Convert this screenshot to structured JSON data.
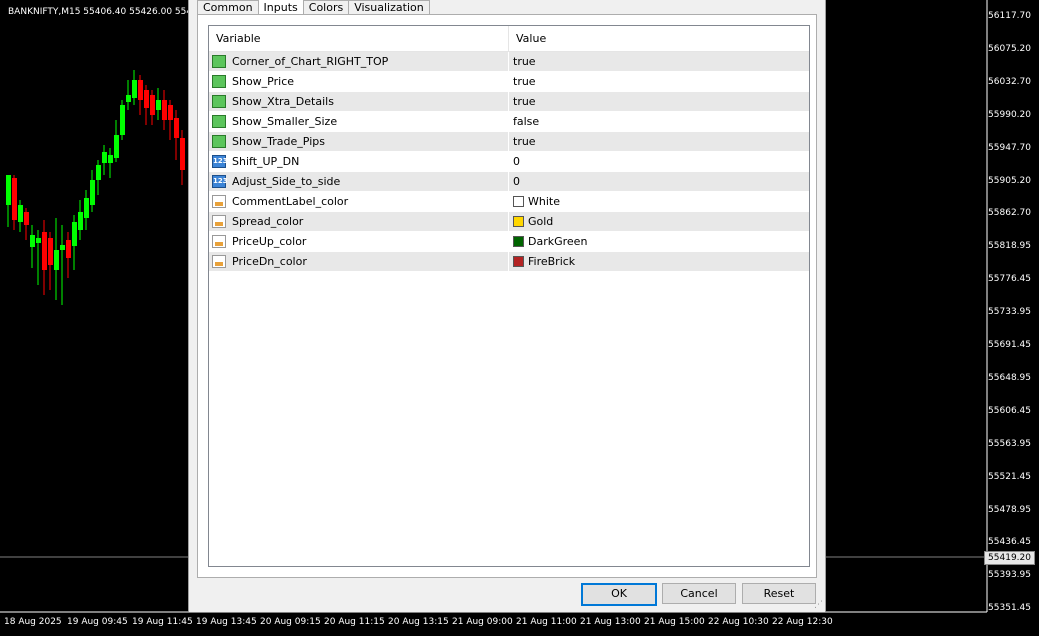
{
  "chart": {
    "title": "BANKNIFTY,M15  55406.40 55426.00 554",
    "y_ticks": [
      "56117.70",
      "56075.20",
      "56032.70",
      "55990.20",
      "55947.70",
      "55905.20",
      "55862.70",
      "55818.95",
      "55776.45",
      "55733.95",
      "55691.45",
      "55648.95",
      "55606.45",
      "55563.95",
      "55521.45",
      "55478.95",
      "55436.45",
      "55393.95",
      "55351.45"
    ],
    "current_price": "55419.20",
    "x_ticks": [
      "18 Aug 2025",
      "19 Aug 09:45",
      "19 Aug 11:45",
      "19 Aug 13:45",
      "20 Aug 09:15",
      "20 Aug 11:15",
      "20 Aug 13:15",
      "21 Aug 09:00",
      "21 Aug 11:00",
      "21 Aug 13:00",
      "21 Aug 15:00",
      "22 Aug 10:30",
      "22 Aug 12:30"
    ],
    "up_color": "#00ff00",
    "down_color": "#ff0000"
  },
  "dialog": {
    "tabs": [
      "Common",
      "Inputs",
      "Colors",
      "Visualization"
    ],
    "active_tab": "Inputs",
    "columns": {
      "variable": "Variable",
      "value": "Value"
    },
    "rows": [
      {
        "name": "Corner_of_Chart_RIGHT_TOP",
        "value": "true",
        "icon": "bool-icon"
      },
      {
        "name": "Show_Price",
        "value": "true",
        "icon": "bool-icon"
      },
      {
        "name": "Show_Xtra_Details",
        "value": "true",
        "icon": "bool-icon"
      },
      {
        "name": "Show_Smaller_Size",
        "value": "false",
        "icon": "bool-icon"
      },
      {
        "name": "Show_Trade_Pips",
        "value": "true",
        "icon": "bool-icon"
      },
      {
        "name": "Shift_UP_DN",
        "value": "0",
        "icon": "int-icon",
        "icon_text": "123"
      },
      {
        "name": "Adjust_Side_to_side",
        "value": "0",
        "icon": "int-icon",
        "icon_text": "123"
      },
      {
        "name": "CommentLabel_color",
        "value": "White",
        "icon": "color-icon",
        "swatch": "#ffffff"
      },
      {
        "name": "Spread_color",
        "value": "Gold",
        "icon": "color-icon",
        "swatch": "#ffd700"
      },
      {
        "name": "PriceUp_color",
        "value": "DarkGreen",
        "icon": "color-icon",
        "swatch": "#006400"
      },
      {
        "name": "PriceDn_color",
        "value": "FireBrick",
        "icon": "color-icon",
        "swatch": "#b22222"
      }
    ],
    "buttons": {
      "ok": "OK",
      "cancel": "Cancel",
      "reset": "Reset"
    }
  }
}
